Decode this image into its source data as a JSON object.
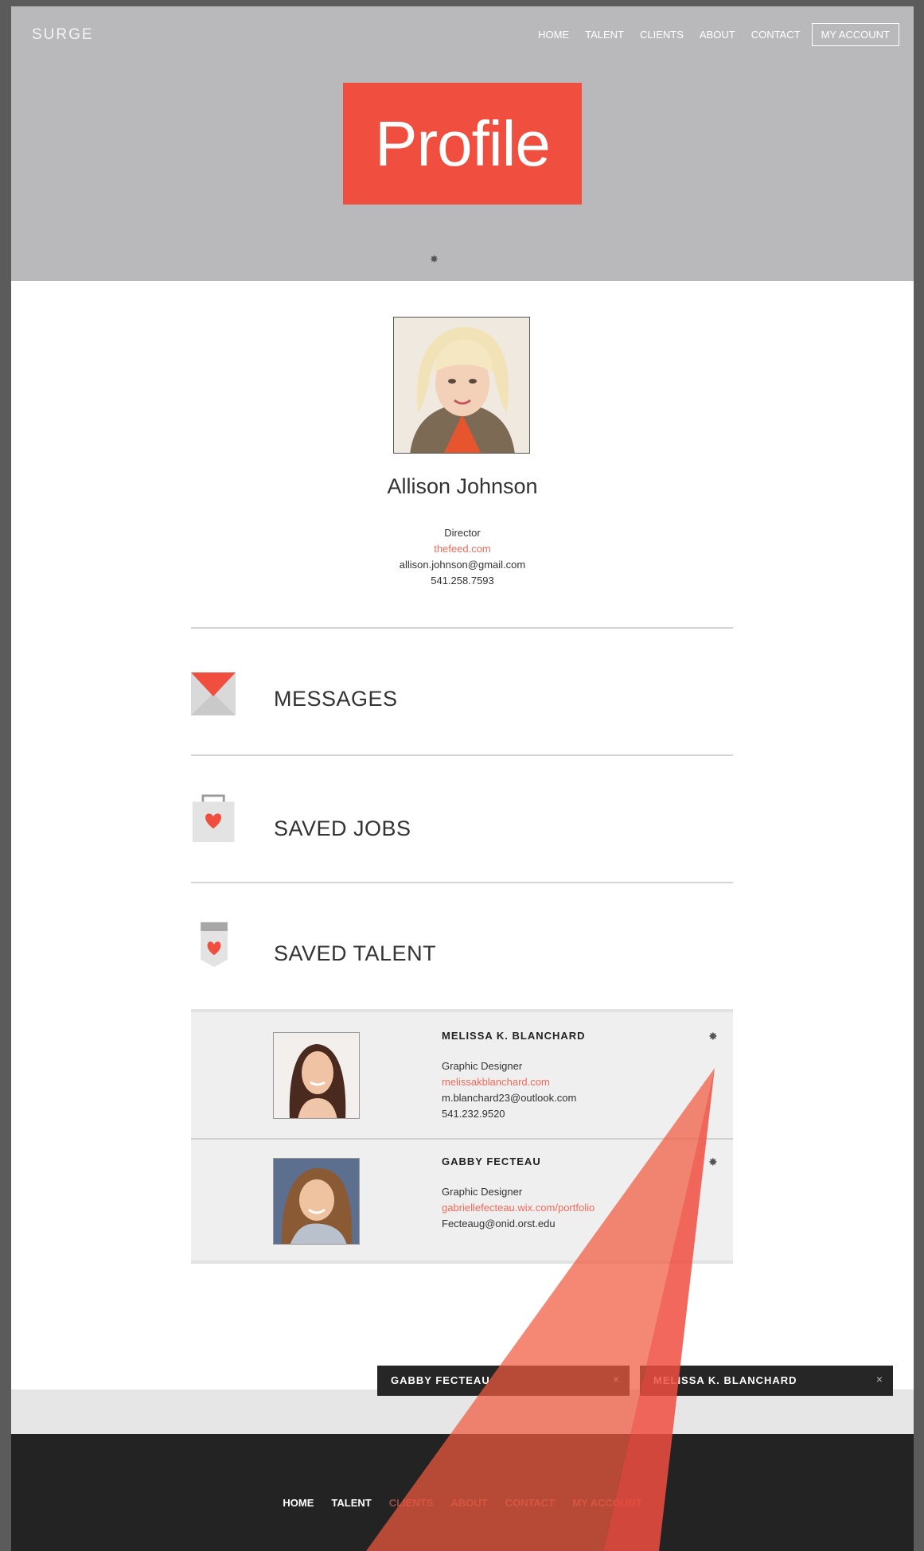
{
  "header": {
    "brand": "SURGE",
    "nav": [
      "HOME",
      "TALENT",
      "CLIENTS",
      "ABOUT",
      "CONTACT"
    ],
    "account_label": "MY ACCOUNT",
    "title": "Profile"
  },
  "profile": {
    "name": "Allison Johnson",
    "role": "Director",
    "website": "thefeed.com",
    "email": "allison.johnson@gmail.com",
    "phone": "541.258.7593"
  },
  "sections": {
    "messages": "MESSAGES",
    "saved_jobs": "SAVED JOBS",
    "saved_talent": "SAVED TALENT"
  },
  "talent": [
    {
      "name": "MELISSA K. BLANCHARD",
      "role": "Graphic Designer",
      "website": "melissakblanchard.com",
      "email": "m.blanchard23@outlook.com",
      "phone": "541.232.9520"
    },
    {
      "name": "GABBY FECTEAU",
      "role": "Graphic Designer",
      "website": "gabriellefecteau.wix.com/portfolio",
      "email": "Fecteaug@onid.orst.edu"
    }
  ],
  "chat_tabs": [
    {
      "name": "GABBY FECTEAU",
      "close": "×"
    },
    {
      "name": "MELISSA K. BLANCHARD",
      "close": "×"
    }
  ],
  "footer": {
    "nav": [
      "HOME",
      "TALENT",
      "CLIENTS",
      "ABOUT",
      "CONTACT",
      "MY ACCOUNT"
    ]
  },
  "colors": {
    "accent": "#f04e3f",
    "hero_bg": "#b9b9bb",
    "footer_bg": "#232323",
    "link": "#f26a5a"
  },
  "icons": {
    "gear": "gear-icon",
    "messages": "envelope-icon",
    "saved_jobs": "bag-heart-icon",
    "saved_talent": "tag-heart-icon",
    "close": "close-icon"
  }
}
